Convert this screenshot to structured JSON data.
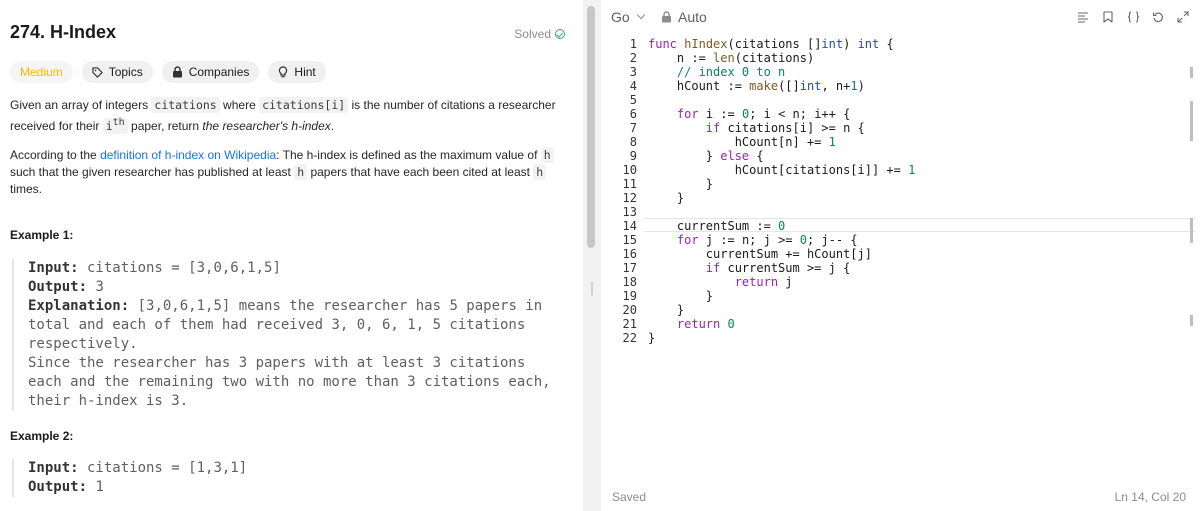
{
  "problem": {
    "title": "274. H-Index",
    "status": "Solved",
    "tags": {
      "difficulty": "Medium",
      "topics": "Topics",
      "companies": "Companies",
      "hint": "Hint"
    },
    "description": {
      "p1": {
        "t1": "Given an array of integers ",
        "c1": "citations",
        "t2": " where ",
        "c2": "citations[i]",
        "t3": " is the number of citations a researcher received for their ",
        "c3": "i",
        "sup": "th",
        "t4": " paper, return ",
        "em": "the researcher's h-index",
        "t5": "."
      },
      "p2": {
        "t1": "According to the ",
        "link": "definition of h-index on Wikipedia",
        "t2": ": The h-index is defined as the maximum value of ",
        "c1": "h",
        "t3": " such that the given researcher has published at least ",
        "c2": "h",
        "t4": " papers that have each been cited at least ",
        "c3": "h",
        "t5": " times."
      }
    },
    "examples": [
      {
        "heading": "Example 1:",
        "input_label": "Input:",
        "input_value": " citations = [3,0,6,1,5]",
        "output_label": "Output:",
        "output_value": " 3",
        "explanation_label": "Explanation:",
        "explanation_value": " [3,0,6,1,5] means the researcher has 5 papers in total and each of them had received 3, 0, 6, 1, 5 citations respectively.",
        "explanation_value2": "Since the researcher has 3 papers with at least 3 citations each and the remaining two with no more than 3 citations each, their h-index is 3."
      },
      {
        "heading": "Example 2:",
        "input_label": "Input:",
        "input_value": " citations = [1,3,1]",
        "output_label": "Output:",
        "output_value": " 1"
      }
    ]
  },
  "editor": {
    "language": "Go",
    "mode": "Auto",
    "saved": "Saved",
    "cursor": "Ln 14, Col 20",
    "toolbar_icons": [
      "format-icon",
      "bookmark-icon",
      "braces-icon",
      "reset-icon",
      "expand-icon"
    ],
    "line_numbers": [
      "1",
      "2",
      "3",
      "4",
      "5",
      "6",
      "7",
      "8",
      "9",
      "10",
      "11",
      "12",
      "13",
      "14",
      "15",
      "16",
      "17",
      "18",
      "19",
      "20",
      "21",
      "22"
    ],
    "code": [
      "func hIndex(citations []int) int {",
      "    n := len(citations)",
      "    // index 0 to n",
      "    hCount := make([]int, n+1)",
      "",
      "    for i := 0; i < n; i++ {",
      "        if citations[i] >= n {",
      "            hCount[n] += 1",
      "        } else {",
      "            hCount[citations[i]] += 1",
      "        }",
      "    }",
      "",
      "    currentSum := 0",
      "    for j := n; j >= 0; j-- {",
      "        currentSum += hCount[j]",
      "        if currentSum >= j {",
      "            return j",
      "        }",
      "    }",
      "    return 0",
      "}"
    ]
  },
  "colors": {
    "difficulty_medium": "#ffb800",
    "solved_check": "#2db55d",
    "link": "#1a73e8",
    "keyword": "#9b23b7",
    "type": "#2345c7",
    "number": "#098658",
    "function": "#795e26"
  }
}
